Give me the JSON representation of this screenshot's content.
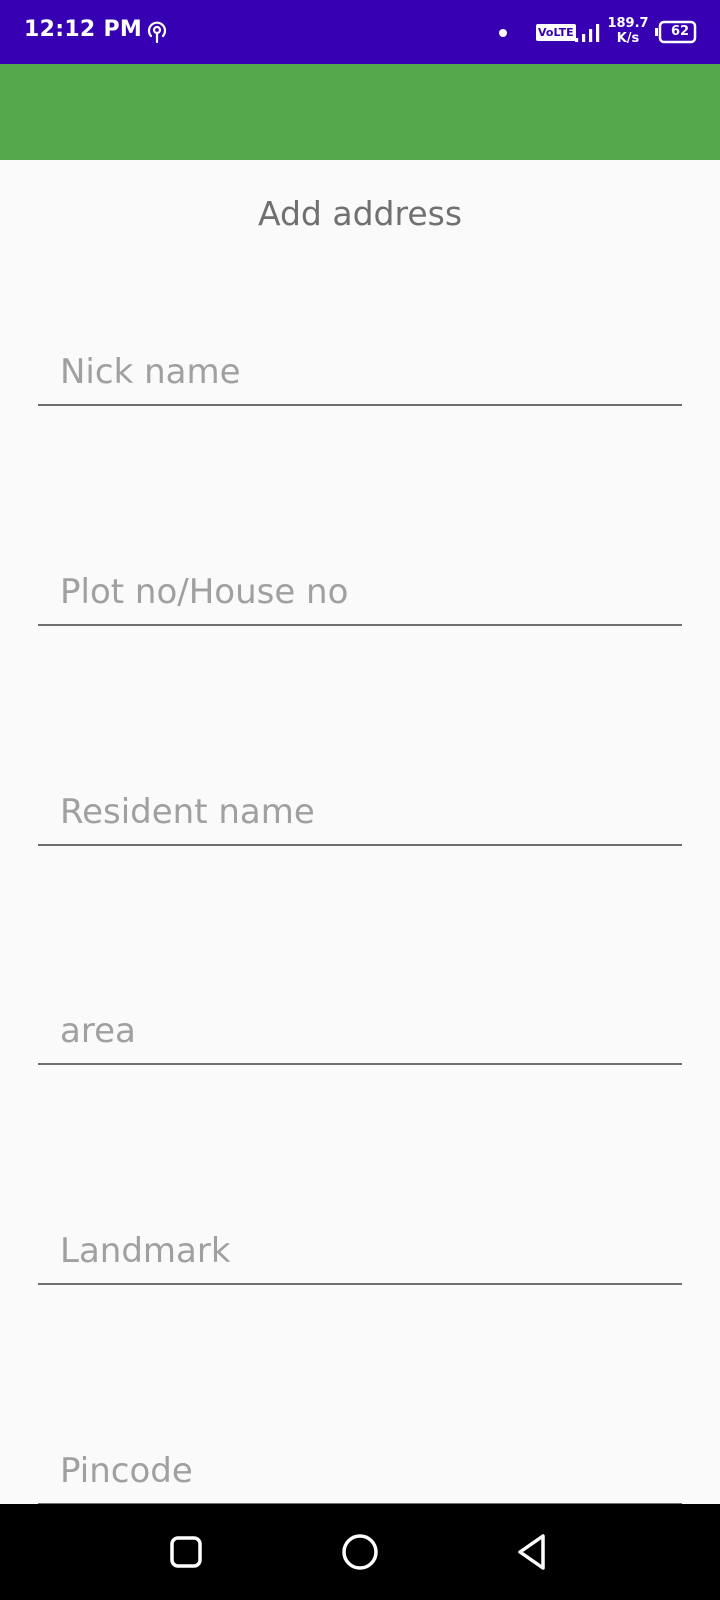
{
  "status_bar": {
    "time": "12:12 PM",
    "network_badge": "VoLTE",
    "net_speed_value": "189.7",
    "net_speed_unit": "K/s",
    "battery_level": "62",
    "icons": [
      "hotspot-icon",
      "notification-dot-icon",
      "signal-icon",
      "battery-icon"
    ],
    "background_color": "#3700b3"
  },
  "app_bar": {
    "color": "#55a84c"
  },
  "page": {
    "title": "Add address"
  },
  "form": {
    "fields": [
      {
        "name": "nick-name",
        "placeholder": "Nick name",
        "value": ""
      },
      {
        "name": "plot-house-no",
        "placeholder": "Plot no/House no",
        "value": ""
      },
      {
        "name": "resident-name",
        "placeholder": "Resident name",
        "value": ""
      },
      {
        "name": "area",
        "placeholder": "area",
        "value": ""
      },
      {
        "name": "landmark",
        "placeholder": "Landmark",
        "value": ""
      },
      {
        "name": "pincode",
        "placeholder": "Pincode",
        "value": ""
      }
    ]
  },
  "nav_bar": {
    "buttons": [
      "recents-button",
      "home-button",
      "back-button"
    ]
  }
}
